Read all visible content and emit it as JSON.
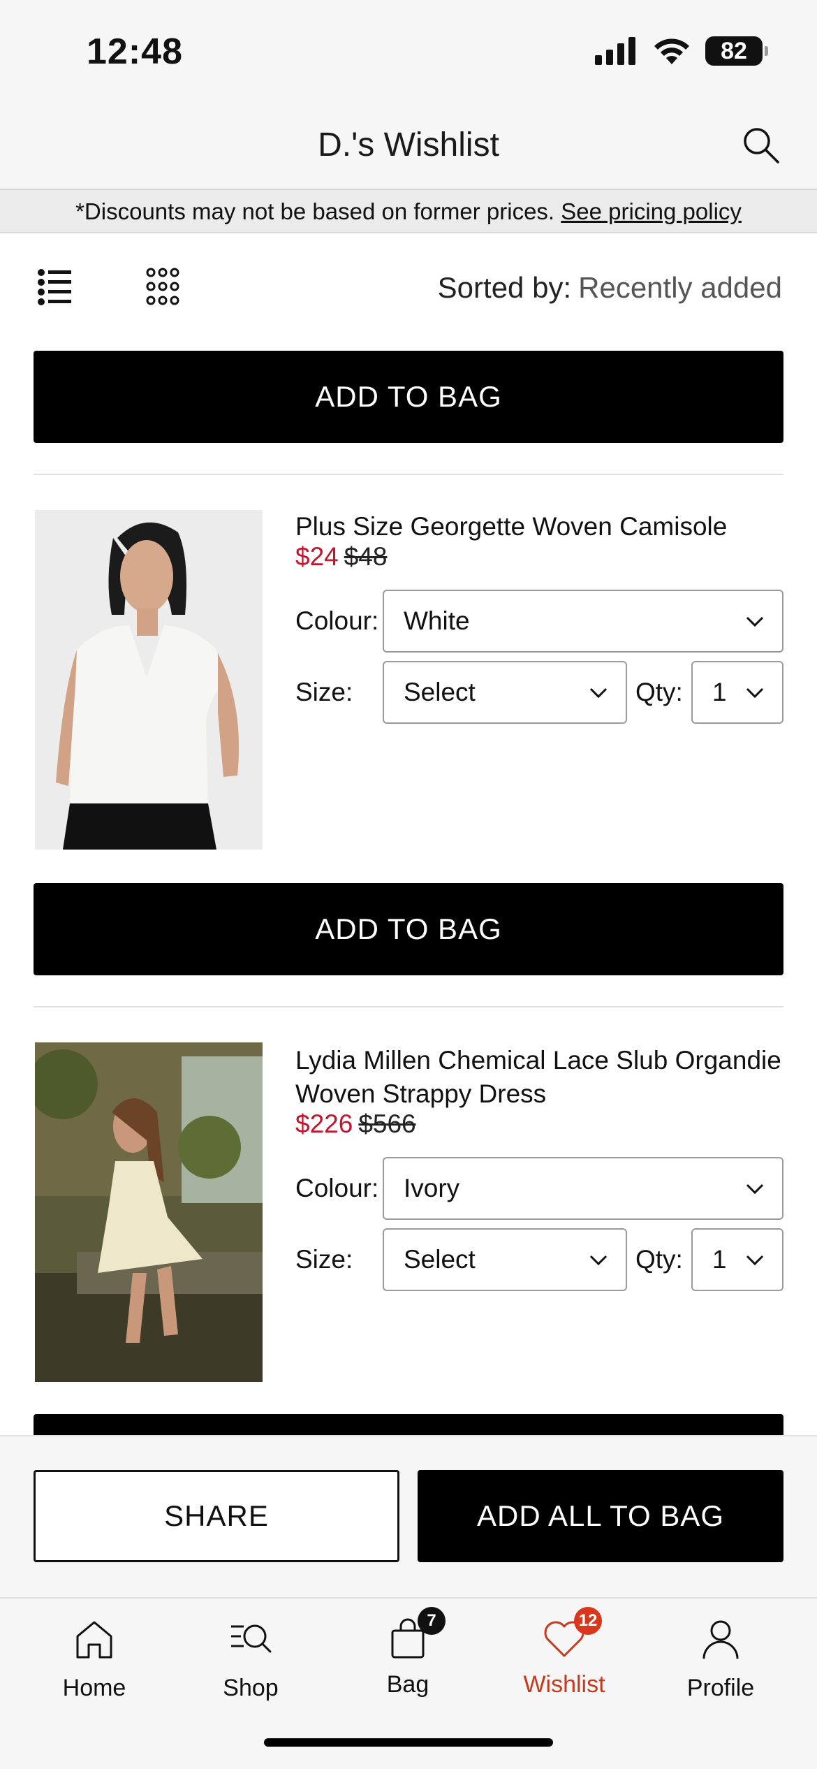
{
  "status_bar": {
    "time": "12:48",
    "battery": "82"
  },
  "header": {
    "title": "D.'s Wishlist"
  },
  "banner": {
    "text": "*Discounts may not be based on former prices.",
    "link": "See pricing policy"
  },
  "toolbar": {
    "sort_label": "Sorted by:",
    "sort_value": "Recently added"
  },
  "add_to_bag_label": "ADD TO BAG",
  "products": [
    {
      "name": "Plus Size Georgette Woven Camisole",
      "sale_price": "$24",
      "original_price": "$48",
      "colour_label": "Colour:",
      "colour": "White",
      "size_label": "Size:",
      "size": "Select",
      "qty_label": "Qty:",
      "qty": "1"
    },
    {
      "name": "Lydia Millen Chemical Lace Slub Organdie Woven Strappy Dress",
      "sale_price": "$226",
      "original_price": "$566",
      "colour_label": "Colour:",
      "colour": "Ivory",
      "size_label": "Size:",
      "size": "Select",
      "qty_label": "Qty:",
      "qty": "1"
    }
  ],
  "actions": {
    "share": "SHARE",
    "add_all": "ADD ALL TO BAG"
  },
  "tabs": [
    {
      "label": "Home",
      "icon": "home-icon"
    },
    {
      "label": "Shop",
      "icon": "shop-search-icon"
    },
    {
      "label": "Bag",
      "icon": "bag-icon",
      "badge": "7"
    },
    {
      "label": "Wishlist",
      "icon": "heart-icon",
      "badge": "12",
      "active": true
    },
    {
      "label": "Profile",
      "icon": "profile-icon"
    }
  ],
  "colors": {
    "sale": "#c4142c",
    "active_tab": "#c43a1c",
    "badge_bag": "#111111",
    "badge_wishlist": "#d8371c"
  }
}
